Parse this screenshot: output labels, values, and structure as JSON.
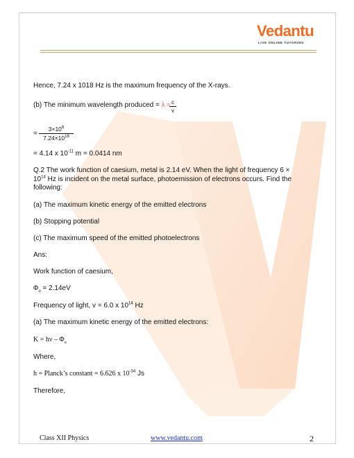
{
  "brand": {
    "name": "Vedantu",
    "tagline": "LIVE ONLINE TUTORING",
    "accent_color": "#f26b21",
    "watermark_color": "#fbe3d2"
  },
  "content": {
    "line1": "Hence, 7.24 x 1018 Hz is the maximum frequency of the X-rays.",
    "b_label": "(b) The minimum wavelength produced = ",
    "lambda_eq": "λ = ",
    "frac_c": "c",
    "frac_v": "v",
    "eq_prefix": "=",
    "big_num_base": "3×10",
    "big_num_exp": "8",
    "big_den_base": "7.24×10",
    "big_den_exp": "18",
    "result_a": "= 4.14 x 10",
    "result_exp": "-11",
    "result_b": " m = 0.0414 nm",
    "q2_line1": "Q.2 The work function of caesium, metal is 2.14 eV. When the light of frequency 6 ×",
    "q2_l2_base": "10",
    "q2_l2_exp": "14",
    "q2_l2_rest": " Hz is incident on the metal surface, photoemission of electrons occurs. Find the",
    "q2_line3": "following:",
    "part_a": "(a) The maximum kinetic energy of the emitted electrons",
    "part_b": "(b) Stopping potential",
    "part_c": "(c) The maximum speed of the emitted photoelectrons",
    "ans": " Ans:",
    "work_fn": "Work function of caesium,",
    "phi_sym": "Φ",
    "phi_sub": "o",
    "phi_val": " = 2.14eV",
    "freq_a": "Frequency of light, v = 6.0 x 10",
    "freq_exp": "14",
    "freq_b": " Hz",
    "ke_heading": "(a) The maximum kinetic energy of the emitted electrons:",
    "ke_eq": "K = hν – Φ",
    "ke_sub": "o",
    "where": "Where,",
    "h_a": "h = Planck’s constant = 6.626 x 10",
    "h_exp": "-34",
    "h_b": " Js",
    "therefore": "Therefore,"
  },
  "footer": {
    "left": "Class XII Physics",
    "link": "www.vedantu.com",
    "page_number": "2"
  }
}
